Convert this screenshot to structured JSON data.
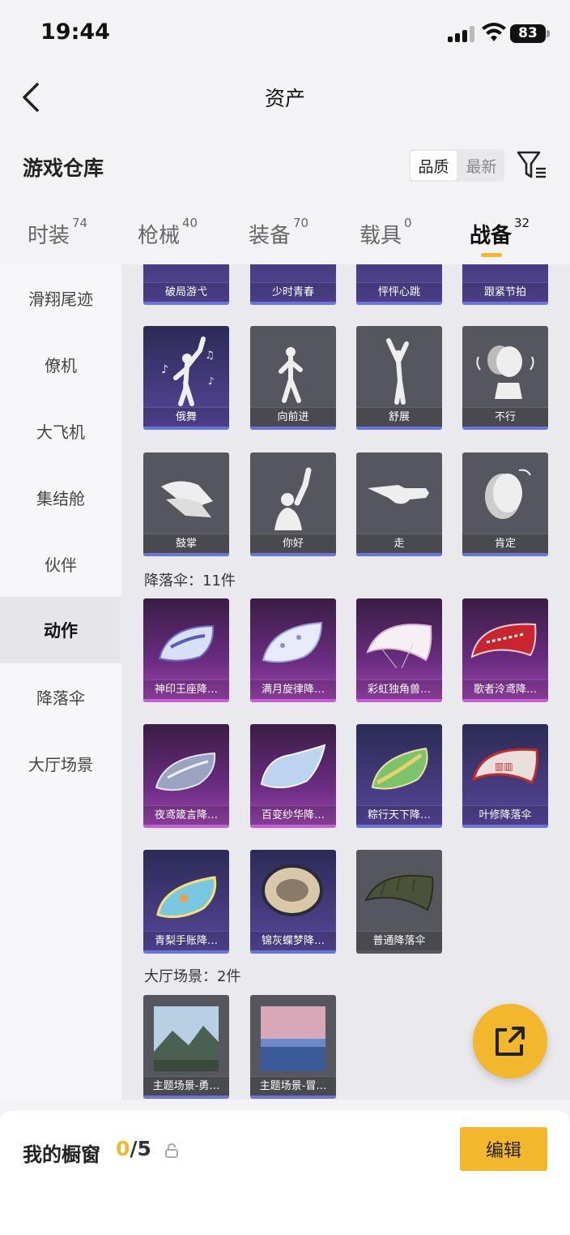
{
  "status_bar": {
    "time": "19:44",
    "battery": "83"
  },
  "nav": {
    "title": "资产"
  },
  "warehouse": {
    "title": "游戏仓库"
  },
  "sort": {
    "options": [
      "品质",
      "最新"
    ],
    "active": "品质"
  },
  "category_tabs": [
    {
      "label": "时装",
      "count": "74"
    },
    {
      "label": "枪械",
      "count": "40"
    },
    {
      "label": "装备",
      "count": "70"
    },
    {
      "label": "载具",
      "count": "0"
    },
    {
      "label": "战备",
      "count": "32",
      "active": true
    }
  ],
  "side_nav": {
    "items": [
      "滑翔尾迹",
      "僚机",
      "大飞机",
      "集结舱",
      "伙伴",
      "动作",
      "降落伞",
      "大厅场景"
    ],
    "active": "动作"
  },
  "action_cards_row1": [
    "破局游弋",
    "少时青春",
    "怦怦心跳",
    "跟紧节拍"
  ],
  "action_cards_row2": [
    "俄舞",
    "向前进",
    "舒展",
    "不行"
  ],
  "action_cards_row3": [
    "鼓掌",
    "你好",
    "走",
    "肯定"
  ],
  "parachute_section": {
    "label": "降落伞：11件"
  },
  "parachute_cards": [
    "神印王座降…",
    "满月旋律降…",
    "彩虹独角兽…",
    "歌者泠鸢降…",
    "夜鸢箴言降…",
    "百变纱华降…",
    "粽行天下降…",
    "叶修降落伞",
    "青梨手账降…",
    "锦灰蝶梦降…",
    "普通降落伞"
  ],
  "lobby_section": {
    "label": "大厅场景：2件"
  },
  "lobby_cards": [
    "主题场景-勇…",
    "主题场景-冒…"
  ],
  "showcase": {
    "label": "我的橱窗",
    "current": "0",
    "total": "/5",
    "edit_label": "编辑"
  },
  "colors": {
    "accent": "#f2b72c",
    "rare_bar": "#6b74d8",
    "epic_bar": "#c65fd6"
  }
}
